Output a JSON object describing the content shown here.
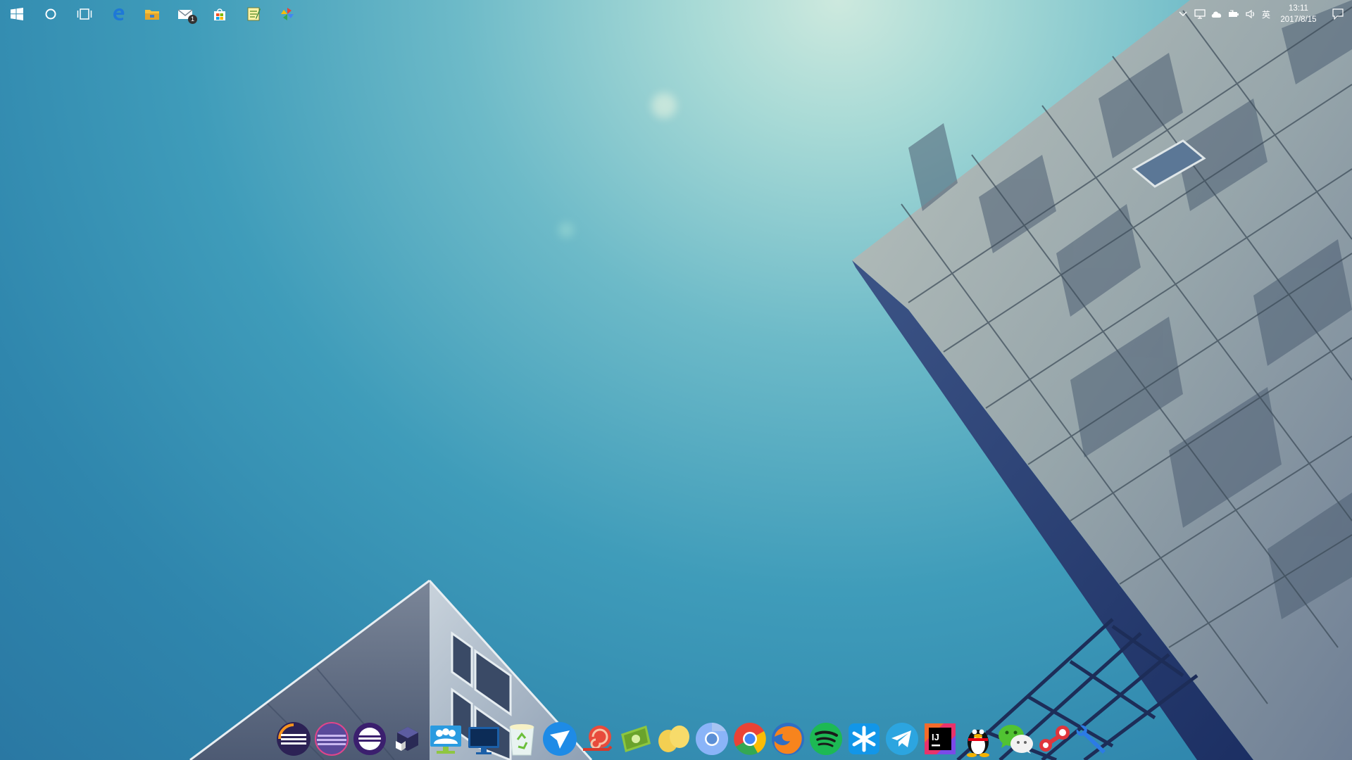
{
  "taskbar": {
    "left_items": [
      {
        "name": "start-button",
        "icon": "windows-logo-icon"
      },
      {
        "name": "cortana-button",
        "icon": "cortana-circle-icon"
      },
      {
        "name": "task-view-button",
        "icon": "task-view-icon"
      },
      {
        "name": "edge-button",
        "icon": "edge-icon"
      },
      {
        "name": "file-explorer-button",
        "icon": "folder-icon"
      },
      {
        "name": "mail-button",
        "icon": "mail-icon",
        "badge": "1"
      },
      {
        "name": "store-button",
        "icon": "store-icon"
      },
      {
        "name": "notepad-button",
        "icon": "notepad-icon"
      },
      {
        "name": "gallery-button",
        "icon": "pinwheel-icon"
      }
    ],
    "tray": {
      "ime_label": "英",
      "time": "13:11",
      "date": "2017/8/15"
    }
  },
  "dock": {
    "apps": [
      "eclipse",
      "eclipse-alt",
      "eclipse-purple",
      "cube-box",
      "contacts",
      "monitor",
      "recycle-bin",
      "paper-plane",
      "snail",
      "cash",
      "yellow-eggs",
      "chromium",
      "chrome",
      "firefox",
      "spotify",
      "snowflake-app",
      "telegram",
      "intellij-idea",
      "qq",
      "wechat",
      "steam",
      "wrench-tool"
    ]
  },
  "colors": {
    "sky_top": "#cde9de",
    "sky_bottom": "#2a78a3",
    "building": "#8a9ba8"
  }
}
